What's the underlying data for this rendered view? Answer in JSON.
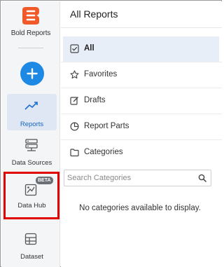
{
  "brand": {
    "name": "Bold Reports",
    "accent": "#ef5a28"
  },
  "sidebar": {
    "add_button_color": "#1e88e5",
    "items": [
      {
        "label": "Reports",
        "icon": "trend-chart-icon",
        "active": true
      },
      {
        "label": "Data Sources",
        "icon": "data-sources-icon",
        "active": false
      },
      {
        "label": "Data Hub",
        "icon": "data-hub-icon",
        "active": false,
        "badge": "BETA"
      },
      {
        "label": "Dataset",
        "icon": "dataset-icon",
        "active": false
      }
    ]
  },
  "main": {
    "title": "All Reports",
    "menu": [
      {
        "label": "All",
        "icon": "checkbox-icon",
        "active": true
      },
      {
        "label": "Favorites",
        "icon": "star-icon",
        "active": false
      },
      {
        "label": "Drafts",
        "icon": "edit-icon",
        "active": false
      },
      {
        "label": "Report Parts",
        "icon": "pie-icon",
        "active": false
      },
      {
        "label": "Categories",
        "icon": "folder-icon",
        "active": false
      }
    ],
    "search": {
      "placeholder": "Search Categories",
      "value": ""
    },
    "empty_message": "No categories available to display."
  },
  "annotation": {
    "highlight_color": "#e00000",
    "target": "Data Hub"
  }
}
